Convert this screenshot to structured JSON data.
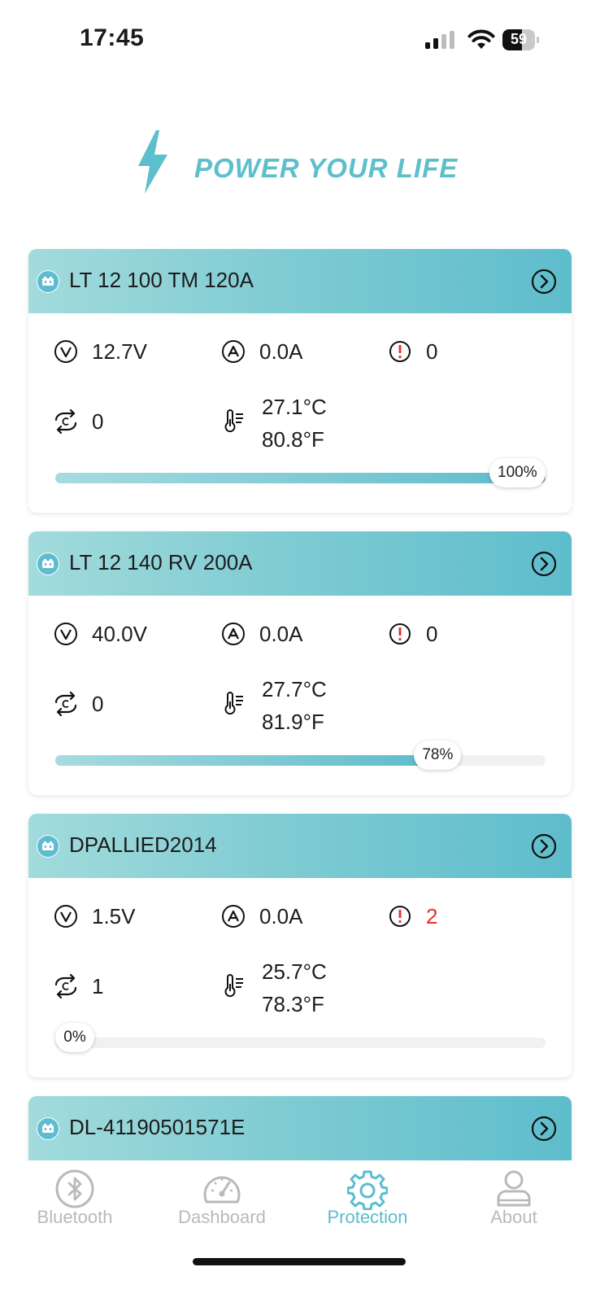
{
  "status_bar": {
    "time": "17:45",
    "battery": "59"
  },
  "logo": {
    "text": "POWER YOUR LIFE"
  },
  "devices": [
    {
      "name": "LT 12 100 TM 120A",
      "voltage": "12.7V",
      "current": "0.0A",
      "alarms": "0",
      "cycles": "0",
      "temp_c": "27.1°C",
      "temp_f": "80.8°F",
      "soc_label": "100%",
      "soc": 1.0
    },
    {
      "name": "LT 12 140 RV 200A",
      "voltage": "40.0V",
      "current": "0.0A",
      "alarms": "0",
      "cycles": "0",
      "temp_c": "27.7°C",
      "temp_f": "81.9°F",
      "soc_label": "78%",
      "soc": 0.78
    },
    {
      "name": "DPALLIED2014",
      "voltage": "1.5V",
      "current": "0.0A",
      "alarms": "2",
      "cycles": "1",
      "temp_c": "25.7°C",
      "temp_f": "78.3°F",
      "soc_label": "0%",
      "soc": 0.0
    },
    {
      "name": "DL-41190501571E"
    }
  ],
  "tabs": [
    {
      "label": "Bluetooth",
      "icon": "bluetooth-icon"
    },
    {
      "label": "Dashboard",
      "icon": "speedometer-icon"
    },
    {
      "label": "Protection",
      "icon": "gear-icon"
    },
    {
      "label": "About",
      "icon": "user-icon"
    }
  ],
  "colors": {
    "accent": "#5bbcce",
    "header_gradient_start": "#a2dbdc",
    "header_gradient_end": "#5ebdcc",
    "alert": "#e0322e",
    "inactive_tab": "#b9b9b9"
  }
}
